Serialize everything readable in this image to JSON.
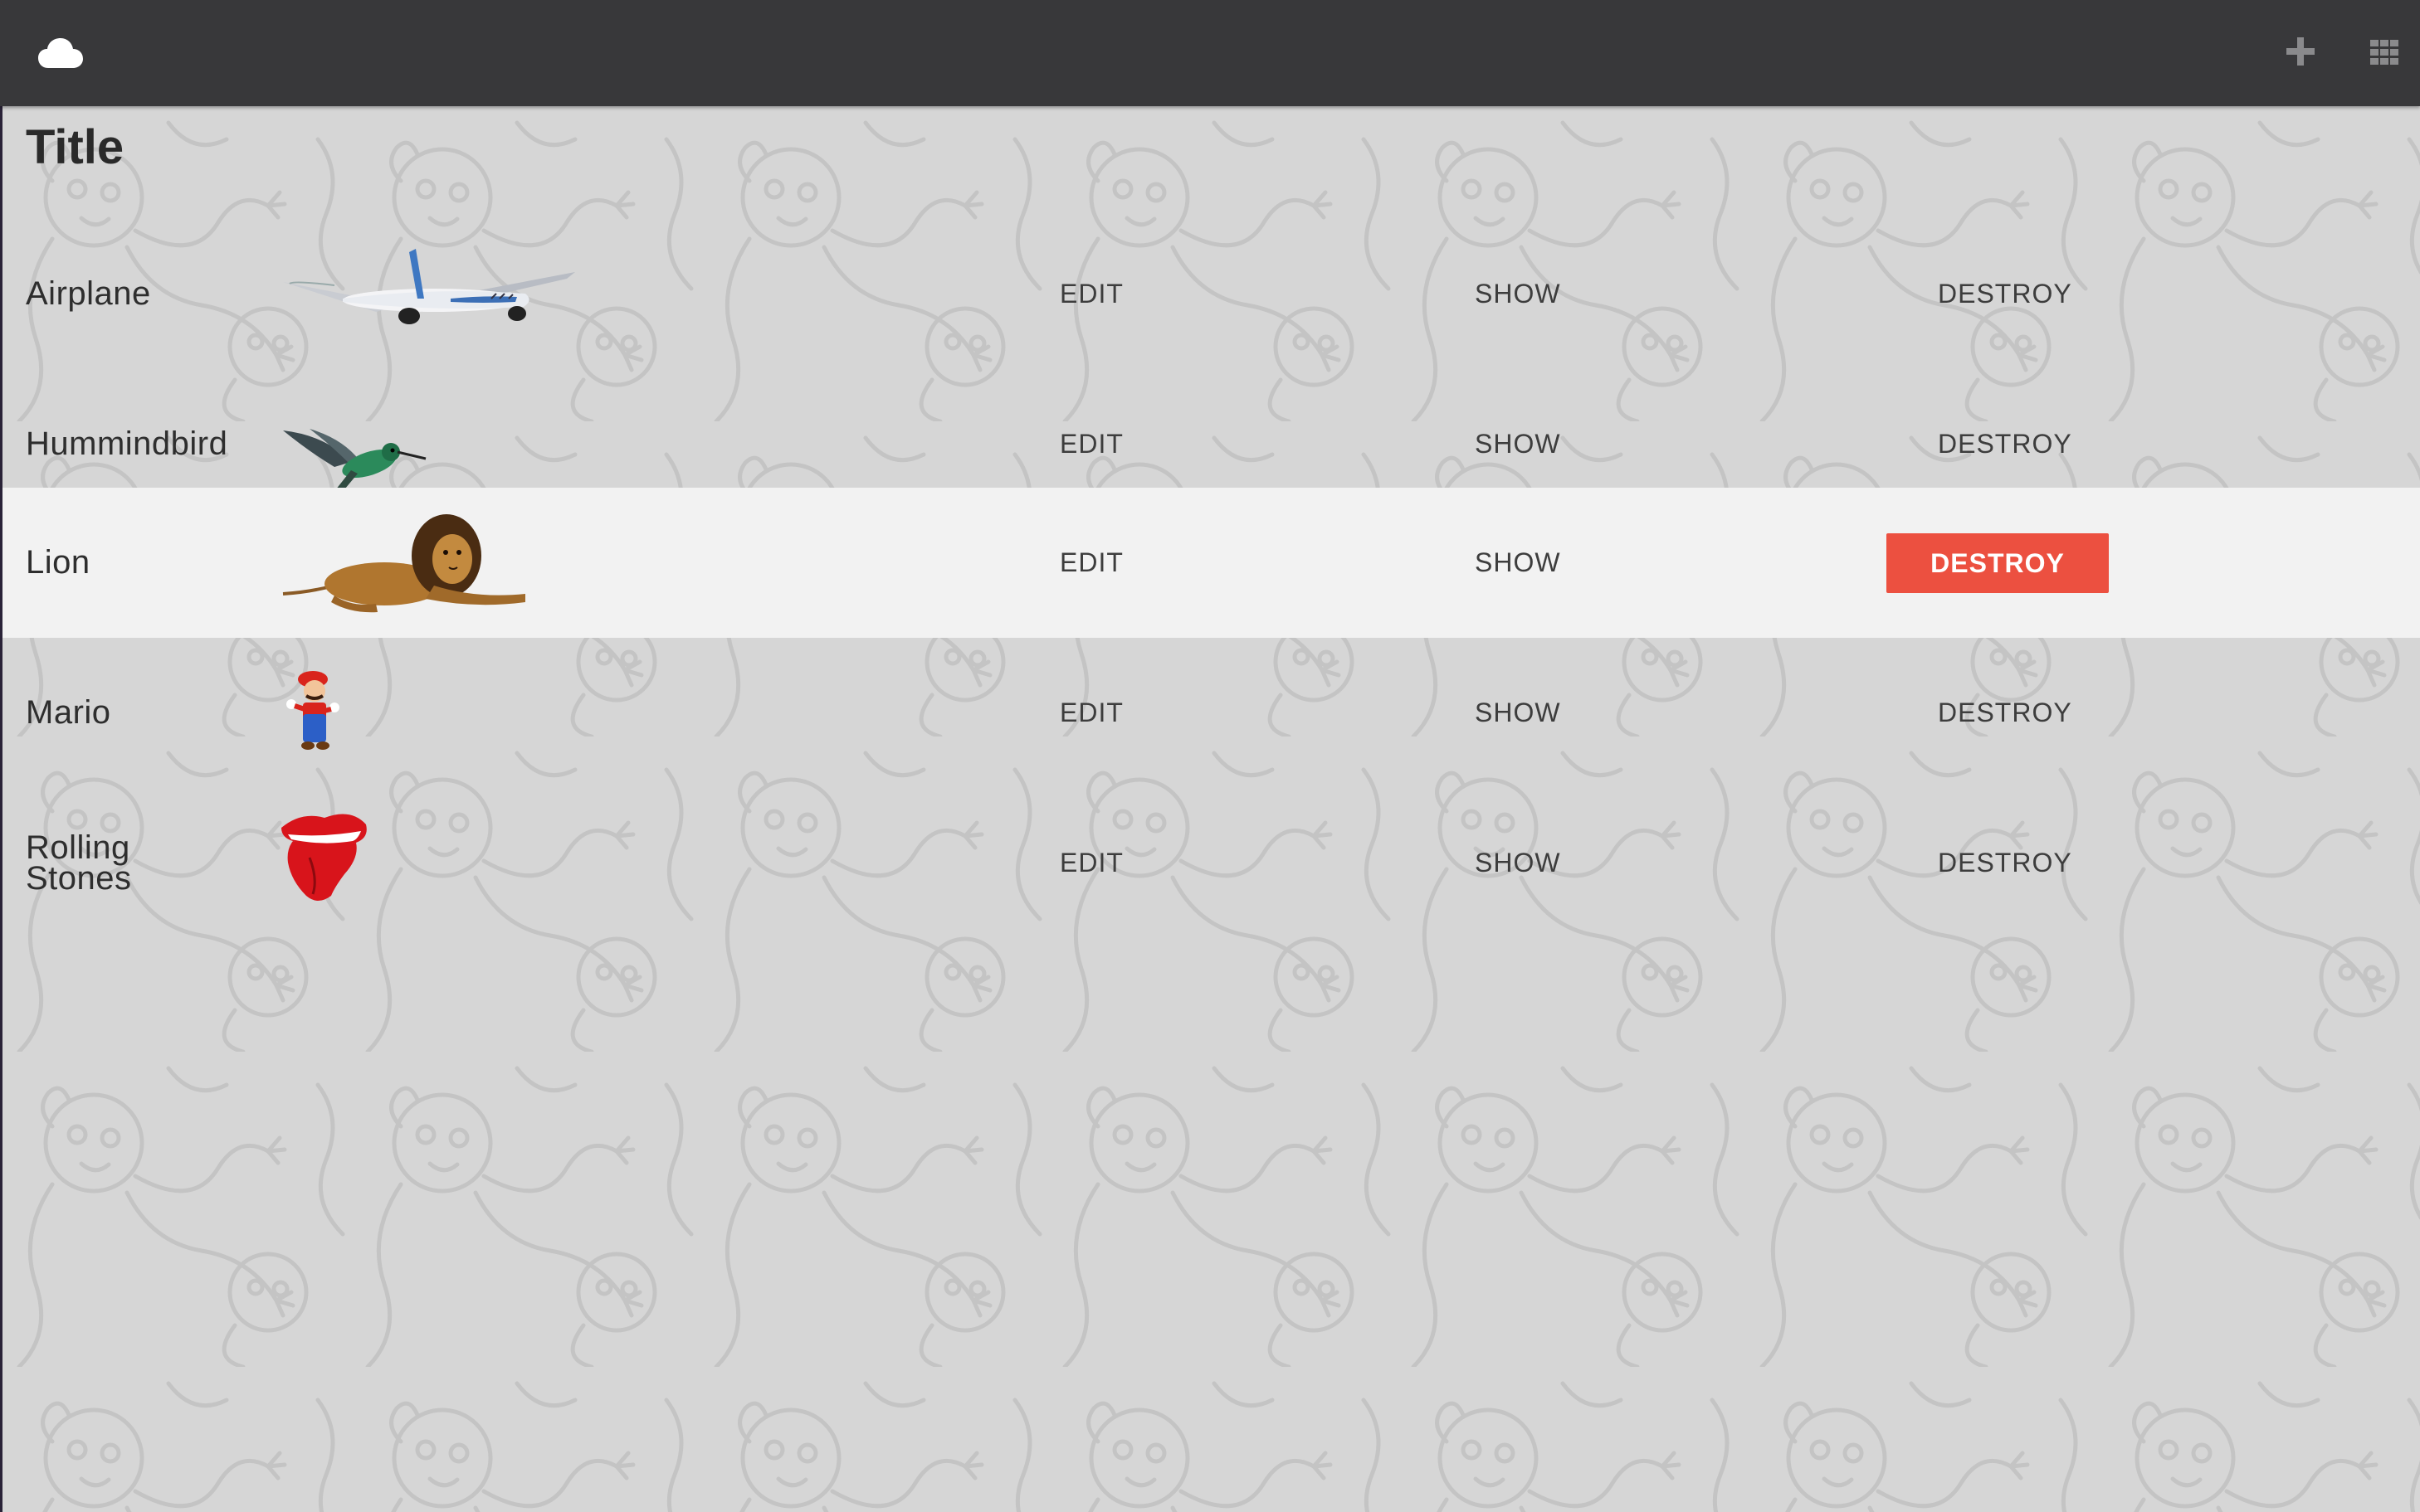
{
  "header": {
    "logo_icon": "cloud-icon",
    "add_icon": "plus-icon",
    "apps_icon": "grid-icon"
  },
  "main": {
    "heading": "Title",
    "rows": [
      {
        "name": "Airplane",
        "image": "airplane-image",
        "edit": "EDIT",
        "show": "SHOW",
        "destroy": "DESTROY"
      },
      {
        "name": "Hummindbird",
        "image": "hummingbird-image",
        "edit": "EDIT",
        "show": "SHOW",
        "destroy": "DESTROY"
      },
      {
        "name": "Lion",
        "image": "lion-image",
        "edit": "EDIT",
        "show": "SHOW",
        "destroy": "DESTROY"
      },
      {
        "name": "Mario",
        "image": "mario-image",
        "edit": "EDIT",
        "show": "SHOW",
        "destroy": "DESTROY"
      },
      {
        "name": "Rolling Stones",
        "image": "rolling-stones-logo",
        "edit": "EDIT",
        "show": "SHOW",
        "destroy": "DESTROY"
      }
    ]
  },
  "colors": {
    "topbar": "#38383a",
    "background": "#d6d6d6",
    "row_highlight": "#f2f2f2",
    "destroy_accent": "#ec5040"
  }
}
